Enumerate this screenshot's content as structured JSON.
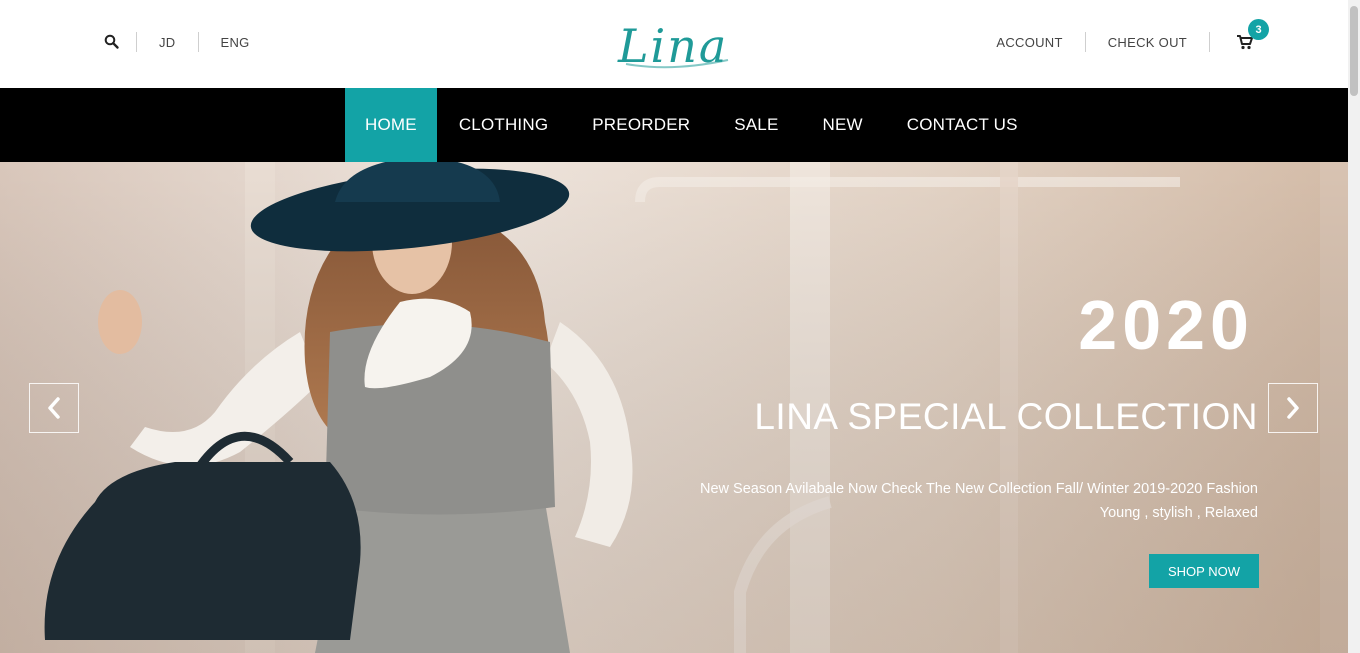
{
  "header": {
    "left_links": [
      "JD",
      "ENG"
    ],
    "logo_text": "Lina",
    "account_label": "ACCOUNT",
    "checkout_label": "CHECK OUT",
    "cart_count": "3"
  },
  "nav": {
    "items": [
      "HOME",
      "CLOTHING",
      "PREORDER",
      "SALE",
      "NEW",
      "CONTACT US"
    ],
    "active": "HOME"
  },
  "hero": {
    "year": "2020",
    "title": "LINA SPECIAL COLLECTION",
    "description_line1": "New Season Avilabale Now Check The New Collection Fall/ Winter 2019-2020 Fashion",
    "description_line2": "Young , stylish , Relaxed",
    "cta_label": "SHOP NOW"
  },
  "colors": {
    "accent": "#13a3a6",
    "nav_background": "#000000",
    "text_dark": "#444444"
  },
  "icons": [
    "search-icon",
    "cart-icon",
    "chevron-left-icon",
    "chevron-right-icon"
  ]
}
